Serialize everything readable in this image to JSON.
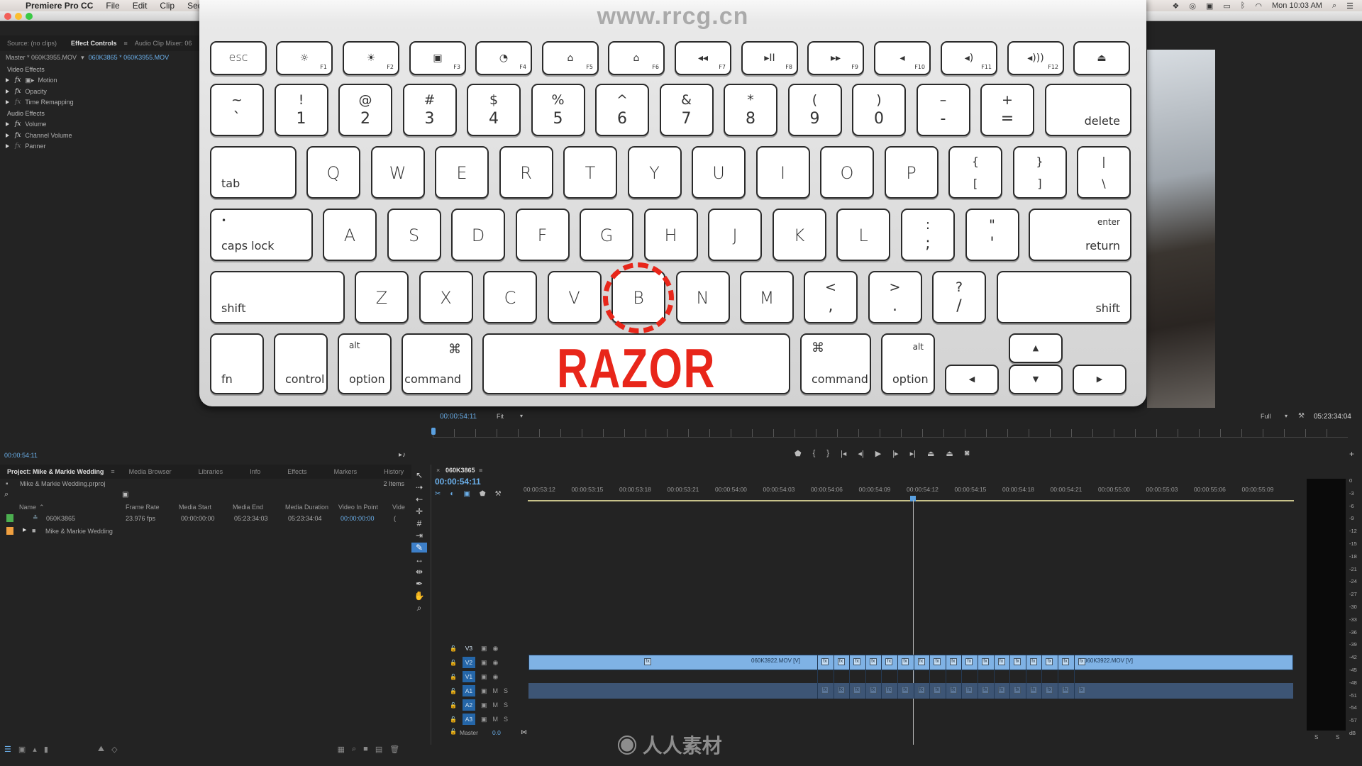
{
  "menubar": {
    "app_name": "Premiere Pro CC",
    "items": [
      "File",
      "Edit",
      "Clip",
      "Sequence"
    ],
    "clock": "Mon 10:03 AM",
    "status_icons": [
      "dropbox-icon",
      "creative-cloud-icon",
      "camera-icon",
      "airplay-icon",
      "bluetooth-icon",
      "wifi-icon",
      "search-icon",
      "list-icon"
    ]
  },
  "effect_controls": {
    "tabs": [
      "Source: (no clips)",
      "Effect Controls",
      "Audio Clip Mixer: 06"
    ],
    "master_label": "Master * 060K3955.MOV",
    "clip_label": "060K3865 * 060K3955.MOV",
    "video_section": "Video Effects",
    "video_effects": [
      "Motion",
      "Opacity",
      "Time Remapping"
    ],
    "audio_section": "Audio Effects",
    "audio_effects": [
      "Volume",
      "Channel Volume",
      "Panner"
    ],
    "timecode": "00:00:54:11"
  },
  "keyboard": {
    "watermark_url": "www.rrcg.cn",
    "function_row": [
      {
        "label": "esc"
      },
      {
        "label": "☼",
        "fn": "F1"
      },
      {
        "label": "☀",
        "fn": "F2"
      },
      {
        "label": "▣",
        "fn": "F3"
      },
      {
        "label": "◔",
        "fn": "F4"
      },
      {
        "label": "⌂",
        "fn": "F5"
      },
      {
        "label": "⌂",
        "fn": "F6"
      },
      {
        "label": "◂◂",
        "fn": "F7"
      },
      {
        "label": "▸II",
        "fn": "F8"
      },
      {
        "label": "▸▸",
        "fn": "F9"
      },
      {
        "label": "◂",
        "fn": "F10"
      },
      {
        "label": "◂)",
        "fn": "F11"
      },
      {
        "label": "◂)))",
        "fn": "F12"
      },
      {
        "label": "⏏"
      }
    ],
    "number_row": [
      {
        "top": "~",
        "bot": "`"
      },
      {
        "top": "!",
        "bot": "1"
      },
      {
        "top": "@",
        "bot": "2"
      },
      {
        "top": "#",
        "bot": "3"
      },
      {
        "top": "$",
        "bot": "4"
      },
      {
        "top": "%",
        "bot": "5"
      },
      {
        "top": "^",
        "bot": "6"
      },
      {
        "top": "&",
        "bot": "7"
      },
      {
        "top": "*",
        "bot": "8"
      },
      {
        "top": "(",
        "bot": "9"
      },
      {
        "top": ")",
        "bot": "0"
      },
      {
        "top": "–",
        "bot": "-"
      },
      {
        "top": "+",
        "bot": "="
      }
    ],
    "delete_label": "delete",
    "tab_label": "tab",
    "qwerty_row": [
      "Q",
      "W",
      "E",
      "R",
      "T",
      "Y",
      "U",
      "I",
      "O",
      "P"
    ],
    "bracket_keys": [
      {
        "top": "{",
        "bot": "["
      },
      {
        "top": "}",
        "bot": "]"
      },
      {
        "top": "|",
        "bot": "\\"
      }
    ],
    "caps_label": "caps lock",
    "home_row": [
      "A",
      "S",
      "D",
      "F",
      "G",
      "H",
      "J",
      "K",
      "L"
    ],
    "home_punct": [
      {
        "top": ":",
        "bot": ";"
      },
      {
        "top": "\"",
        "bot": "'"
      }
    ],
    "enter_label": "enter",
    "return_label": "return",
    "shift_label": "shift",
    "bottom_letters": [
      "Z",
      "X",
      "C",
      "V",
      "B",
      "N",
      "M"
    ],
    "bottom_punct": [
      {
        "top": "<",
        "bot": ","
      },
      {
        "top": ">",
        "bot": "."
      },
      {
        "top": "?",
        "bot": "/"
      }
    ],
    "fn_label": "fn",
    "control_label": "control",
    "alt_label": "alt",
    "option_label": "option",
    "command_symbol": "⌘",
    "command_label": "command",
    "arrows": {
      "up": "▲",
      "down": "▼",
      "left": "◀",
      "right": "▶"
    },
    "highlighted_key": "B",
    "shortcut_caption": "RAZOR",
    "highlight_color": "#e8261a"
  },
  "program_monitor": {
    "timecode": "00:00:54:11",
    "zoom": "Fit",
    "quality": "Full",
    "duration": "05:23:34:04",
    "transport_icons": [
      "marker-icon",
      "mark-in-icon",
      "mark-out-icon",
      "go-to-in-icon",
      "step-back-icon",
      "play-icon",
      "step-forward-icon",
      "go-to-out-icon",
      "lift-icon",
      "extract-icon",
      "export-frame-icon"
    ]
  },
  "project": {
    "tabs": [
      "Project: Mike & Markie Wedding",
      "Media Browser",
      "Libraries",
      "Info",
      "Effects",
      "Markers",
      "History"
    ],
    "file": "Mike & Markie Wedding.prproj",
    "item_count": "2 Items",
    "columns": [
      "Name",
      "Frame Rate",
      "Media Start",
      "Media End",
      "Media Duration",
      "Video In Point",
      "Vide"
    ],
    "rows": [
      {
        "color": "#4caf50",
        "name": "060K3865",
        "frame_rate": "23.976 fps",
        "media_start": "00:00:00:00",
        "media_end": "05:23:34:03",
        "media_duration": "05:23:34:04",
        "video_in": "00:00:00:00",
        "extra": "("
      },
      {
        "color": "#f0a040",
        "name": "Mike & Markie Wedding",
        "frame_rate": "",
        "media_start": "",
        "media_end": "",
        "media_duration": "",
        "video_in": "",
        "extra": ""
      }
    ]
  },
  "timeline": {
    "sequence_name": "060K3865",
    "timecode": "00:00:54:11",
    "ruler": [
      "00:00:53:12",
      "00:00:53:15",
      "00:00:53:18",
      "00:00:53:21",
      "00:00:54:00",
      "00:00:54:03",
      "00:00:54:06",
      "00:00:54:09",
      "00:00:54:12",
      "00:00:54:15",
      "00:00:54:18",
      "00:00:54:21",
      "00:00:55:00",
      "00:00:55:03",
      "00:00:55:06",
      "00:00:55:09"
    ],
    "tracks": [
      {
        "name": "V3",
        "targeted": false,
        "kind": "video"
      },
      {
        "name": "V2",
        "targeted": true,
        "kind": "video"
      },
      {
        "name": "V1",
        "targeted": true,
        "kind": "video"
      },
      {
        "name": "A1",
        "targeted": true,
        "kind": "audio"
      },
      {
        "name": "A2",
        "targeted": true,
        "kind": "audio"
      },
      {
        "name": "A3",
        "targeted": true,
        "kind": "audio"
      }
    ],
    "master_label": "Master",
    "master_value": "0.0",
    "clip_label_left": "060K3922.MOV [V]",
    "clip_label_right": "060K3922.MOV [V]",
    "mute_label": "M",
    "solo_label": "S",
    "tools": [
      "selection-tool",
      "track-select-forward-tool",
      "track-select-backward-tool",
      "ripple-edit-tool",
      "rolling-edit-tool",
      "rate-stretch-tool",
      "razor-tool",
      "slip-tool",
      "slide-tool",
      "pen-tool",
      "hand-tool",
      "zoom-tool"
    ],
    "active_tool": "razor-tool"
  },
  "audio_meter": {
    "scale": [
      "0",
      "-3",
      "-6",
      "-9",
      "-12",
      "-15",
      "-18",
      "-21",
      "-24",
      "-27",
      "-30",
      "-33",
      "-36",
      "-39",
      "-42",
      "-45",
      "-48",
      "-51",
      "-54",
      "-57",
      "dB"
    ],
    "solo_labels": [
      "S",
      "S"
    ]
  }
}
